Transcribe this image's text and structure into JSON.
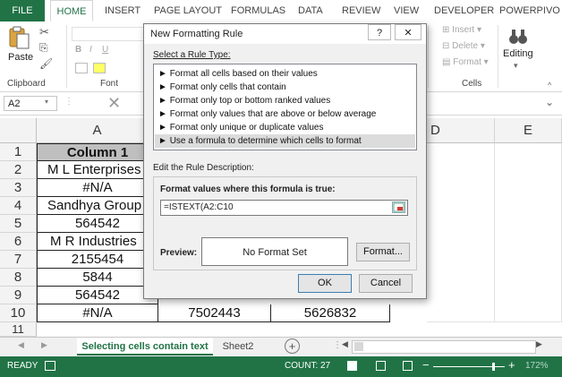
{
  "ribbon_tabs": [
    "FILE",
    "HOME",
    "INSERT",
    "PAGE LAYOUT",
    "FORMULAS",
    "DATA",
    "REVIEW",
    "VIEW",
    "DEVELOPER",
    "POWERPIVO"
  ],
  "ribbon": {
    "paste_label": "Paste",
    "clipboard_label": "Clipboard",
    "font_label": "Font",
    "font_bold": "B",
    "font_italic": "I",
    "font_underline": "U",
    "cells_label": "Cells",
    "insert_label": "Insert",
    "delete_label": "Delete",
    "format_label": "Format",
    "editing_label": "Editing"
  },
  "formula_bar": {
    "name_box": "A2"
  },
  "columns": [
    "A",
    "D",
    "E"
  ],
  "rows": [
    "1",
    "2",
    "3",
    "4",
    "5",
    "6",
    "7",
    "8",
    "9",
    "10",
    "11"
  ],
  "column_a": [
    "Column 1",
    "M L Enterprises",
    "#N/A",
    "Sandhya Group",
    "564542",
    "M R Industries",
    "2155454",
    "5844",
    "564542",
    "#N/A"
  ],
  "row10": {
    "b": "7502443",
    "c": "5626832"
  },
  "sheet_tabs": [
    "Selecting cells contain text",
    "Sheet2"
  ],
  "status": {
    "ready": "READY",
    "count": "COUNT: 27",
    "zoom": "172%"
  },
  "dialog": {
    "title": "New Formatting Rule",
    "help": "?",
    "close": "✕",
    "select_rule_type_label": "Select a Rule Type:",
    "rule_types": [
      "Format all cells based on their values",
      "Format only cells that contain",
      "Format only top or bottom ranked values",
      "Format only values that are above or below average",
      "Format only unique or duplicate values",
      "Use a formula to determine which cells to format"
    ],
    "edit_description_label": "Edit the Rule Description:",
    "formula_label": "Format values where this formula is true:",
    "formula_value": "=ISTEXT(A2:C10",
    "preview_label": "Preview:",
    "preview_text": "No Format Set",
    "format_button": "Format...",
    "ok_button": "OK",
    "cancel_button": "Cancel"
  },
  "colors": {
    "excel_green": "#217346",
    "selected_rule_bg": "#dcdcdc",
    "header_fill": "#bfbfbf"
  }
}
